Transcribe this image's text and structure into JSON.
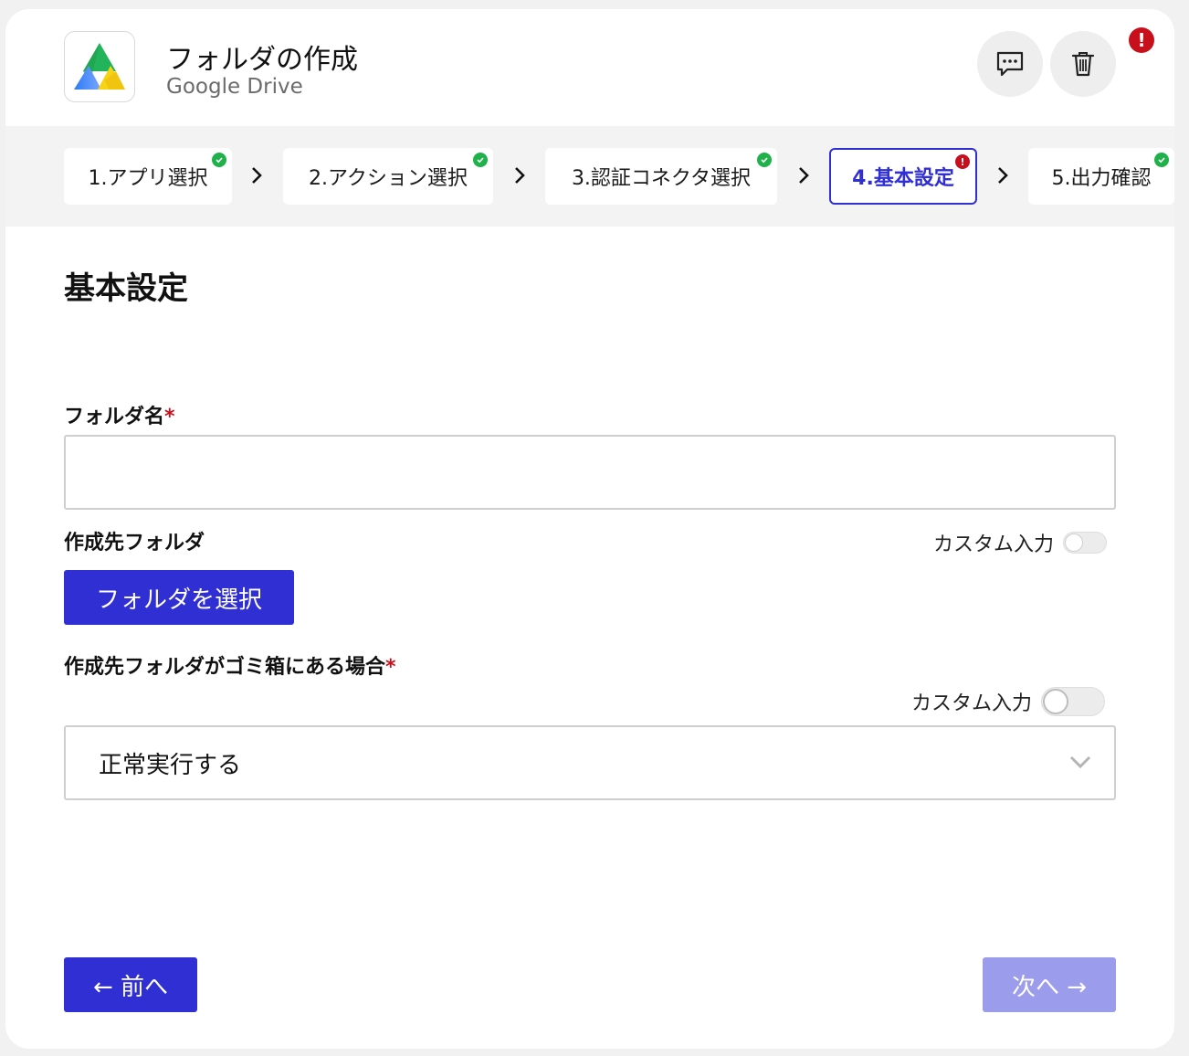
{
  "header": {
    "title": "フォルダの作成",
    "subtitle": "Google Drive",
    "comment_icon": "comment-icon",
    "trash_icon": "trash-icon",
    "error_mark": "!"
  },
  "stepper": {
    "steps": [
      {
        "label": "1.アプリ選択",
        "status": "done"
      },
      {
        "label": "2.アクション選択",
        "status": "done"
      },
      {
        "label": "3.認証コネクタ選択",
        "status": "done"
      },
      {
        "label": "4.基本設定",
        "status": "error",
        "active": true
      },
      {
        "label": "5.出力確認",
        "status": "done"
      }
    ],
    "error_mark": "!"
  },
  "form": {
    "section_title": "基本設定",
    "folder_name": {
      "label": "フォルダ名",
      "required_mark": "*",
      "value": ""
    },
    "parent_folder": {
      "label": "作成先フォルダ",
      "custom_input_label": "カスタム入力",
      "select_button": "フォルダを選択"
    },
    "trash_case": {
      "label": "作成先フォルダがゴミ箱にある場合",
      "required_mark": "*",
      "custom_input_label": "カスタム入力",
      "selected": "正常実行する"
    }
  },
  "footer": {
    "prev": "← 前へ",
    "next": "次へ →"
  },
  "colors": {
    "primary": "#2f2fd4",
    "primary_disabled": "#9c9cec",
    "success": "#1fb24a",
    "error": "#c8101c"
  }
}
